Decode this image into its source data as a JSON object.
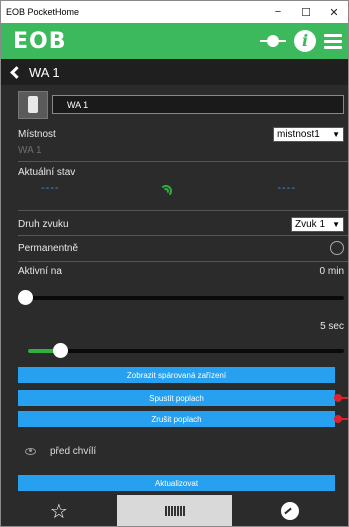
{
  "window": {
    "title": "EOB PocketHome",
    "minimize": "−",
    "maximize": "☐",
    "close": "✕"
  },
  "appbar": {
    "logo": "EOB"
  },
  "header": {
    "title": "WA 1"
  },
  "device": {
    "name_value": "WA 1"
  },
  "room": {
    "label": "Místnost",
    "selected": "mistnost1",
    "subtext": "WA 1"
  },
  "state": {
    "label": "Aktuální stav",
    "left": "----",
    "right": "----"
  },
  "sound": {
    "label": "Druh zvuku",
    "selected": "Zvuk 1"
  },
  "permanent": {
    "label": "Permanentně"
  },
  "active": {
    "label": "Aktivní na",
    "value": "0 min",
    "slider_fraction": 0.0
  },
  "duration": {
    "value": "5 sec",
    "slider_fraction": 0.1
  },
  "buttons": {
    "show_paired": "Zobrazit spárovaná zařízení",
    "start_alarm": "Spustit poplach",
    "stop_alarm": "Zrušit poplach",
    "refresh": "Aktualizovat"
  },
  "last_seen": {
    "text": "před chvílí"
  },
  "colors": {
    "accent": "#3cb95c",
    "button": "#27a0ef",
    "alarm": "#e0202a",
    "background": "#2b2b2b"
  },
  "tabs": [
    {
      "icon": "star-icon"
    },
    {
      "icon": "radiator-icon"
    },
    {
      "icon": "gauge-icon"
    }
  ]
}
